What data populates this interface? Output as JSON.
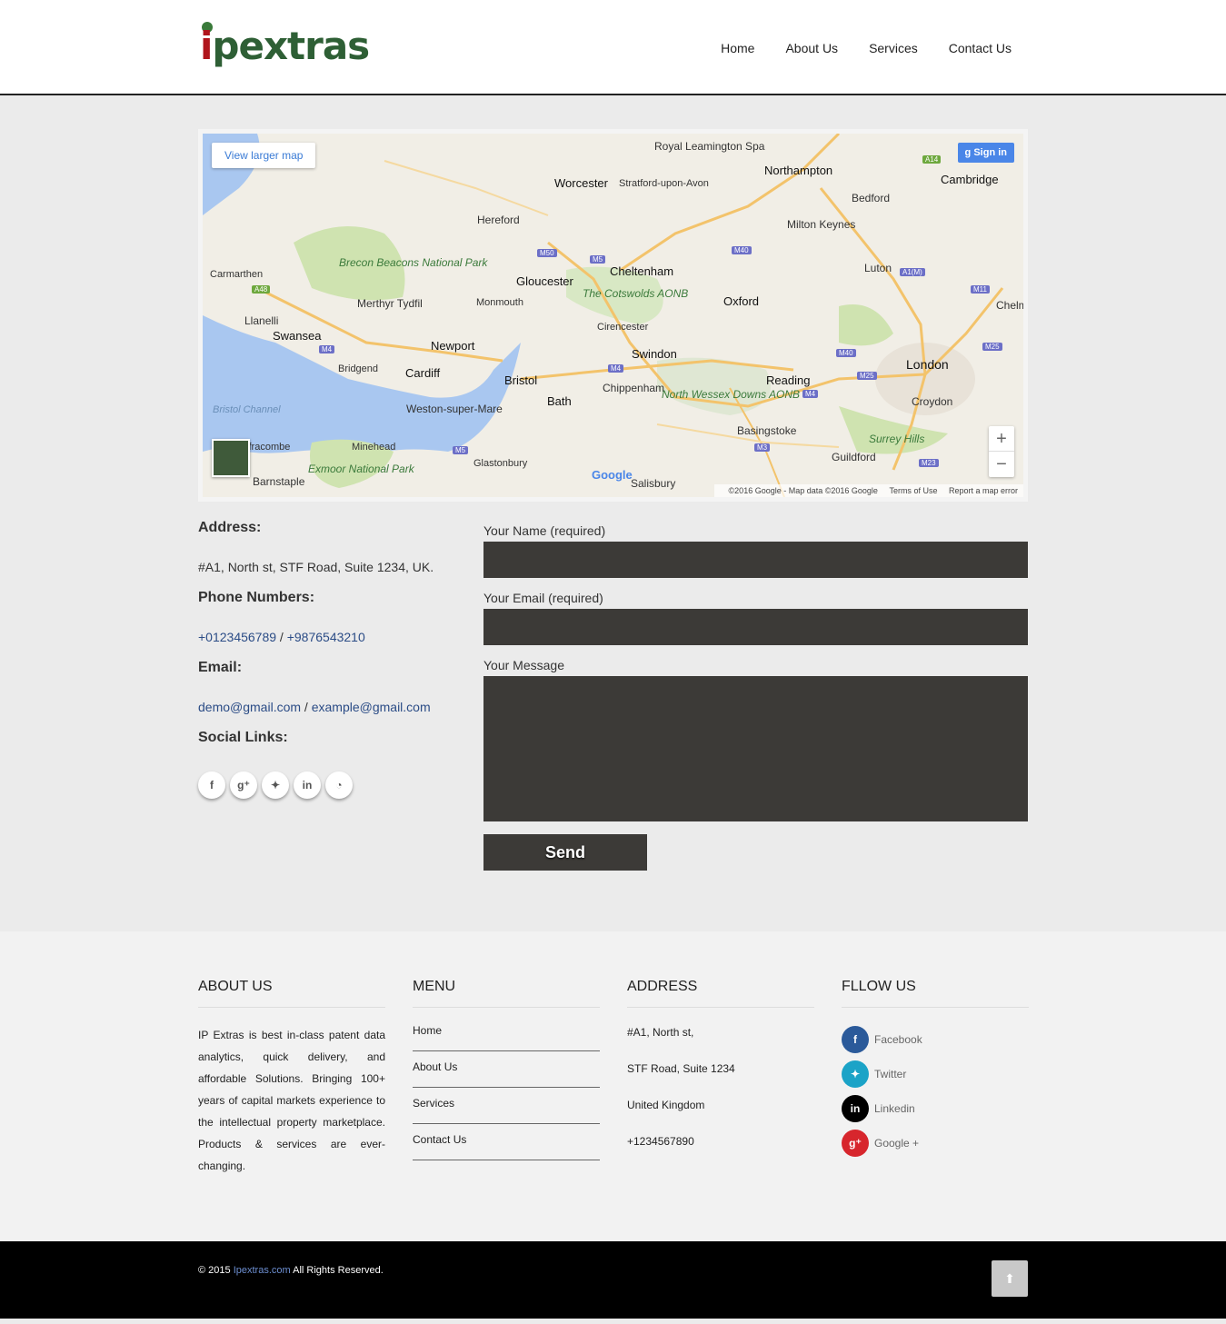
{
  "header": {
    "logo_i": "i",
    "logo_rest": "pextras",
    "nav": [
      "Home",
      "About Us",
      "Services",
      "Contact Us"
    ]
  },
  "map": {
    "view_larger": "View larger map",
    "signin": "Sign in",
    "google": "Google",
    "attribution": "©2016 Google - Map data ©2016 Google",
    "terms": "Terms of Use",
    "report": "Report a map error",
    "zoom_in": "+",
    "zoom_out": "−",
    "labels": [
      "Royal Leamington Spa",
      "Northampton",
      "Worcester",
      "Stratford-upon-Avon",
      "Cambridge",
      "Bedford",
      "Hereford",
      "Milton Keynes",
      "Carmarthen",
      "Brecon Beacons National Park",
      "Gloucester",
      "Cheltenham",
      "Luton",
      "Merthyr Tydfil",
      "Monmouth",
      "The Cotswolds AONB",
      "Oxford",
      "Llanelli",
      "Swansea",
      "Cirencester",
      "Newport",
      "Swindon",
      "London",
      "Bridgend",
      "Cardiff",
      "Bristol",
      "Reading",
      "Chippenham",
      "North Wessex Downs AONB",
      "Bristol Channel",
      "Weston-super-Mare",
      "Bath",
      "Croydon",
      "Basingstoke",
      "Ilfracombe",
      "Minehead",
      "Surrey Hills",
      "Exmoor National Park",
      "Glastonbury",
      "Guildford",
      "Barnstaple",
      "Salisbury",
      "Chelmsford"
    ]
  },
  "contact": {
    "address_title": "Address:",
    "address": "#A1, North st, STF Road, Suite 1234, UK.",
    "phone_title": "Phone Numbers:",
    "phone1": "+0123456789",
    "phone_sep": " / ",
    "phone2": "+9876543210",
    "email_title": "Email:",
    "email1": "demo@gmail.com",
    "email_sep": " / ",
    "email2": "example@gmail.com",
    "social_title": "Social Links:",
    "social_icons": [
      "facebook-icon",
      "google-plus-icon",
      "twitter-icon",
      "linkedin-icon",
      "rss-icon"
    ]
  },
  "form": {
    "name_label": "Your Name (required)",
    "email_label": "Your Email (required)",
    "message_label": "Your Message",
    "send": "Send"
  },
  "footer": {
    "about_title": "ABOUT US",
    "about_text": "IP Extras is best in-class patent data analytics, quick delivery, and affordable Solutions. Bringing 100+ years of capital markets experience to the intellectual property marketplace. Products & services are ever-changing.",
    "menu_title": "MENU",
    "menu": [
      "Home",
      "About Us",
      "Services",
      "Contact Us"
    ],
    "address_title": "ADDRESS",
    "address_lines": [
      "#A1, North st,",
      "STF Road, Suite 1234",
      "United Kingdom",
      "+1234567890"
    ],
    "follow_title": "FLLOW US",
    "follow": [
      {
        "label": "Facebook",
        "color": "#2b5a9a"
      },
      {
        "label": "Twitter",
        "color": "#1ba3c7"
      },
      {
        "label": "Linkedin",
        "color": "#000000"
      },
      {
        "label": "Google +",
        "color": "#d7262d"
      }
    ]
  },
  "bottom": {
    "copy_prefix": "© 2015 ",
    "copy_link": "Ipextras.com",
    "copy_suffix": " All Rights Reserved."
  }
}
